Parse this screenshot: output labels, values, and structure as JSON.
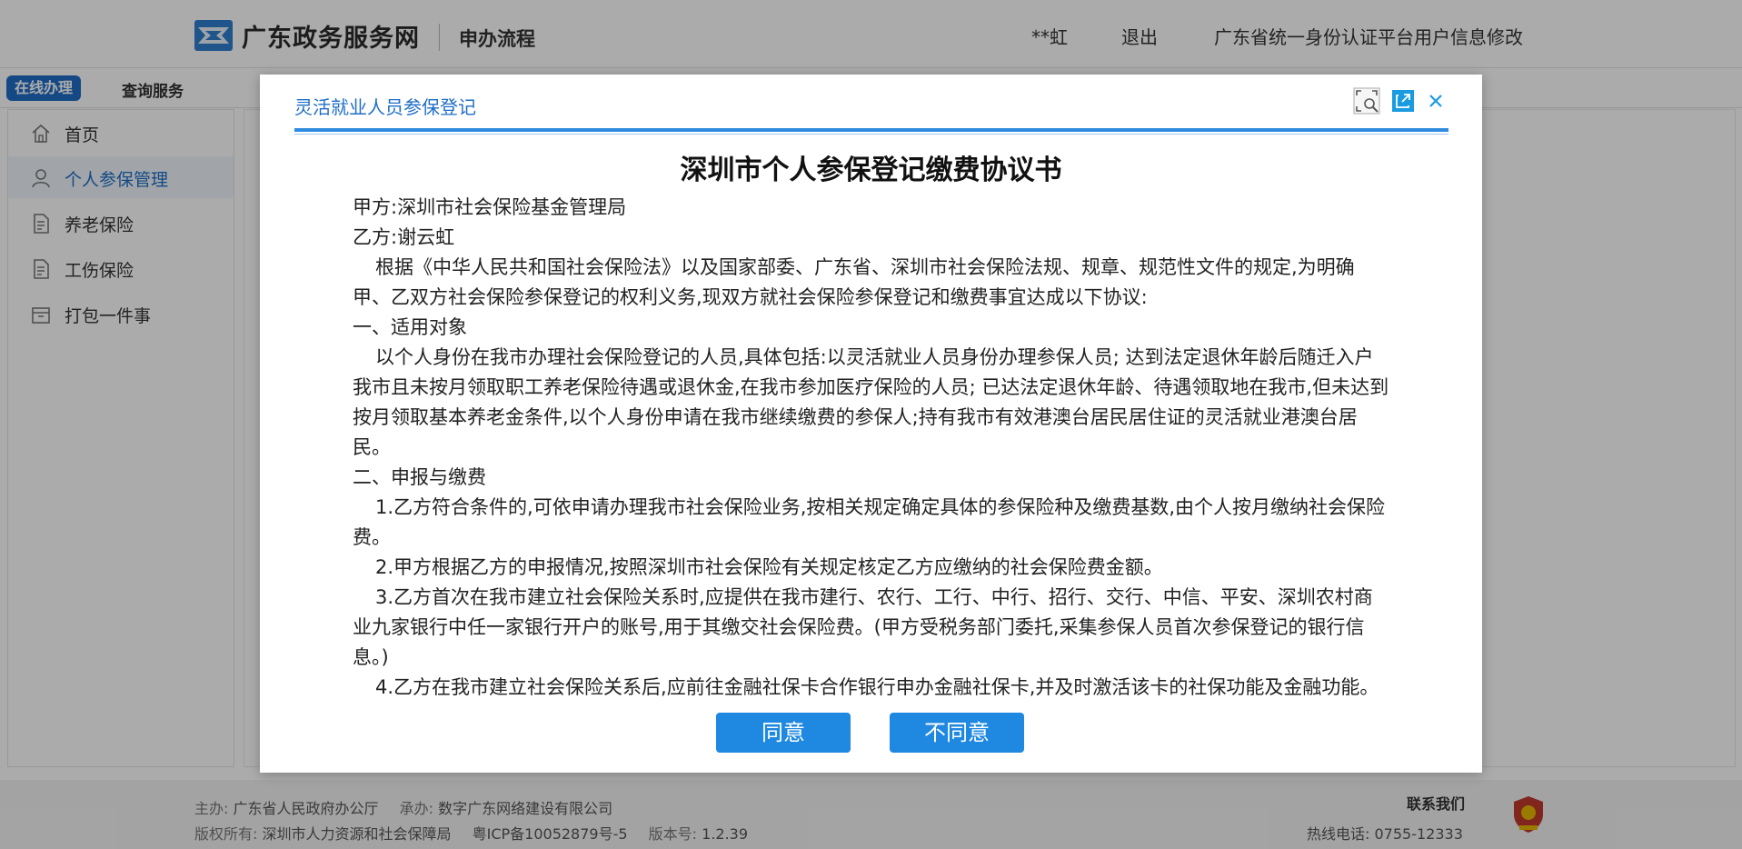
{
  "header": {
    "site_name": "广东政务服务网",
    "subtitle": "申办流程",
    "user": "**虹",
    "logout": "退出",
    "account_edit": "广东省统一身份认证平台用户信息修改"
  },
  "service_tabs": {
    "online": "在线办理",
    "query": "查询服务"
  },
  "sidebar": {
    "items": [
      {
        "label": "首页",
        "icon": "home-icon"
      },
      {
        "label": "个人参保管理",
        "icon": "user-icon"
      },
      {
        "label": "养老保险",
        "icon": "document-icon"
      },
      {
        "label": "工伤保险",
        "icon": "document-icon"
      },
      {
        "label": "打包一件事",
        "icon": "package-icon"
      }
    ]
  },
  "footer": {
    "host_label": "主办:",
    "host": "广东省人民政府办公厅",
    "undertake_label": "承办:",
    "undertake": "数字广东网络建设有限公司",
    "copyright_label": "版权所有:",
    "copyright": "深圳市人力资源和社会保障局",
    "icp": "粤ICP备10052879号-5",
    "version_label": "版本号:",
    "version": "1.2.39",
    "contact_title": "联系我们",
    "hotline": "热线电话: 0755-12333"
  },
  "dialog": {
    "title": "灵活就业人员参保登记",
    "heading": "深圳市个人参保登记缴费协议书",
    "party_a": "甲方:深圳市社会保险基金管理局",
    "party_b": "乙方:谢云虹",
    "intro": "根据《中华人民共和国社会保险法》以及国家部委、广东省、深圳市社会保险法规、规章、规范性文件的规定,为明确甲、乙双方社会保险参保登记的权利义务,现双方就社会保险参保登记和缴费事宜达成以下协议:",
    "section1_title": "一、适用对象",
    "section1_text": "以个人身份在我市办理社会保险登记的人员,具体包括:以灵活就业人员身份办理参保人员; 达到法定退休年龄后随迁入户我市且未按月领取职工养老保险待遇或退休金,在我市参加医疗保险的人员; 已达法定退休年龄、待遇领取地在我市,但未达到按月领取基本养老金条件,以个人身份申请在我市继续缴费的参保人;持有我市有效港澳台居民居住证的灵活就业港澳台居民。",
    "section2_title": "二、申报与缴费",
    "item1": "1.乙方符合条件的,可依申请办理我市社会保险业务,按相关规定确定具体的参保险种及缴费基数,由个人按月缴纳社会保险费。",
    "item2": "2.甲方根据乙方的申报情况,按照深圳市社会保险有关规定核定乙方应缴纳的社会保险费金额。",
    "item3": "3.乙方首次在我市建立社会保险关系时,应提供在我市建行、农行、工行、中行、招行、交行、中信、平安、深圳农村商业九家银行中任一家银行开户的账号,用于其缴交社会保险费。(甲方受税务部门委托,采集参保人员首次参保登记的银行信息。)",
    "item4": "4.乙方在我市建立社会保险关系后,应前往金融社保卡合作银行申办金融社保卡,并及时激活该卡的社保功能及金融功能。",
    "agree": "同意",
    "disagree": "不同意"
  },
  "colors": {
    "accent": "#1f6ec7",
    "button": "#1f88e0",
    "rule": "#2e8be0"
  }
}
